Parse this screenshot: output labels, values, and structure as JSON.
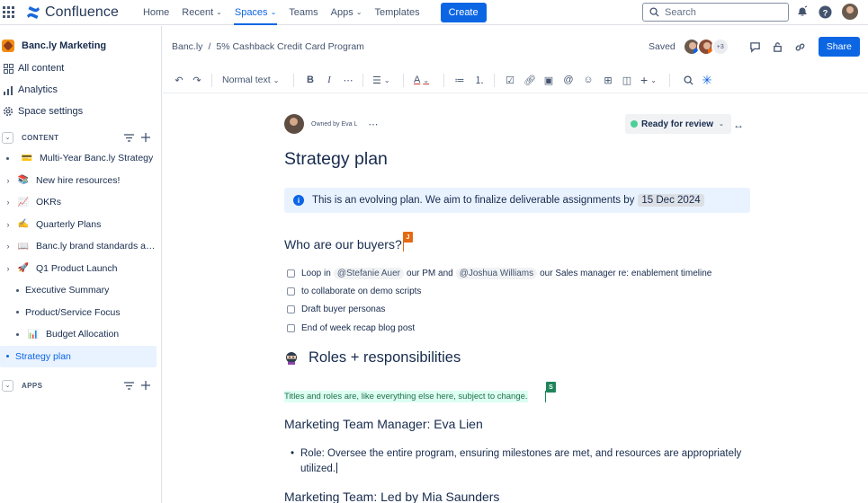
{
  "topnav": {
    "logo_text": "Confluence",
    "items": [
      {
        "label": "Home"
      },
      {
        "label": "Recent"
      },
      {
        "label": "Spaces"
      },
      {
        "label": "Teams"
      },
      {
        "label": "Apps"
      },
      {
        "label": "Templates"
      }
    ],
    "create_label": "Create",
    "search_placeholder": "Search"
  },
  "sidebar": {
    "space_name": "Banc.ly Marketing",
    "links": [
      {
        "label": "All content",
        "icon": "all-content-icon"
      },
      {
        "label": "Analytics",
        "icon": "analytics-icon"
      },
      {
        "label": "Space settings",
        "icon": "gear-icon"
      }
    ],
    "content_section_label": "CONTENT",
    "tree": [
      {
        "label": "Multi-Year Banc.ly Strategy",
        "emoji": "💳"
      },
      {
        "label": "New hire resources!",
        "emoji": "📚"
      },
      {
        "label": "OKRs",
        "emoji": "📈"
      },
      {
        "label": "Quarterly Plans",
        "emoji": "✍️"
      },
      {
        "label": "Banc.ly brand standards an...",
        "emoji": "📖"
      },
      {
        "label": "Q1 Product Launch",
        "emoji": "🚀"
      },
      {
        "label": "Executive Summary"
      },
      {
        "label": "Product/Service Focus"
      },
      {
        "label": "Budget Allocation",
        "emoji": "📊"
      },
      {
        "label": "Strategy plan"
      }
    ],
    "apps_section_label": "APPS"
  },
  "page_header": {
    "breadcrumb": [
      "Banc.ly",
      "/",
      "5% Cashback Credit Card Program"
    ],
    "saved_label": "Saved",
    "collaborators_more": "+3",
    "share_label": "Share"
  },
  "toolbar": {
    "text_style": "Normal text"
  },
  "page": {
    "owner_label": "Owned by Eva L",
    "status_label": "Ready for review",
    "title": "Strategy plan",
    "info_text": "This is an evolving plan. We aim to finalize deliverable assignments by",
    "info_date": "15 Dec 2024",
    "heading_buyers": "Who are our buyers?",
    "cursor_j": "J",
    "tasks": [
      {
        "before": "Loop in",
        "mention1": "@Stefanie Auer",
        "mid": "our PM and",
        "mention2": "@Joshua Williams",
        "after": "our Sales manager re: enablement timeline"
      },
      {
        "text": "to collaborate on demo scripts"
      },
      {
        "text": "Draft buyer personas"
      },
      {
        "text": "End of week recap blog post"
      }
    ],
    "heading_roles": "Roles + responsibilities",
    "highlight_text": "Titles and roles are, like everything else here, subject to change.",
    "cursor_s": "S",
    "heading_manager": "Marketing Team Manager: Eva Lien",
    "role_text": "Role: Oversee the entire program, ensuring milestones are met, and resources are appropriately utilized.",
    "heading_team": "Marketing Team: Led by Mia Saunders"
  },
  "colors": {
    "primary": "#0c66e4",
    "info_bg": "#e9f2ff",
    "status_dot": "#4bce97",
    "highlight_bg": "#dcfff1",
    "cursor_j": "#e56910",
    "cursor_s": "#1f845a"
  }
}
